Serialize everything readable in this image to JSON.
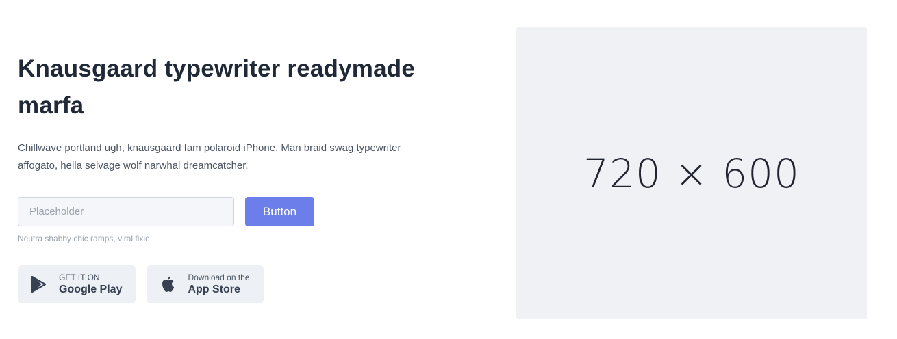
{
  "hero": {
    "title": "Knausgaard typewriter readymade marfa",
    "description": "Chillwave portland ugh, knausgaard fam polaroid iPhone. Man braid swag typewriter affogato, hella selvage wolf narwhal dreamcatcher.",
    "input_placeholder": "Placeholder",
    "button_label": "Button",
    "note": "Neutra shabby chic ramps, viral fixie."
  },
  "stores": [
    {
      "small": "GET IT ON",
      "big": "Google Play",
      "icon": "google-play-icon"
    },
    {
      "small": "Download on the",
      "big": "App Store",
      "icon": "apple-icon"
    }
  ],
  "image_placeholder": {
    "label": "720 × 600"
  },
  "colors": {
    "accent": "#6c7ee9",
    "store_bg": "#edf0f4",
    "image_bg": "#f0f1f5"
  }
}
